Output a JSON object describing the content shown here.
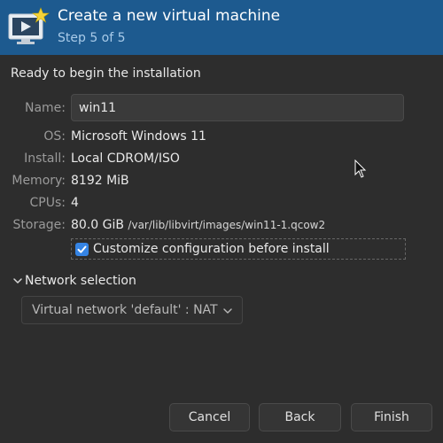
{
  "header": {
    "title": "Create a new virtual machine",
    "subtitle": "Step 5 of 5"
  },
  "ready_text": "Ready to begin the installation",
  "fields": {
    "name_label": "Name:",
    "name_value": "win11",
    "os_label": "OS:",
    "os_value": "Microsoft Windows 11",
    "install_label": "Install:",
    "install_value": "Local CDROM/ISO",
    "memory_label": "Memory:",
    "memory_value": "8192 MiB",
    "cpus_label": "CPUs:",
    "cpus_value": "4",
    "storage_label": "Storage:",
    "storage_size": "80.0 GiB",
    "storage_path": "/var/lib/libvirt/images/win11-1.qcow2"
  },
  "customize": {
    "label": "Customize configuration before install",
    "checked": true
  },
  "network": {
    "expander_label": "Network selection",
    "selected": "Virtual network 'default' : NAT"
  },
  "buttons": {
    "cancel": "Cancel",
    "back": "Back",
    "finish": "Finish"
  },
  "colors": {
    "header_bg": "#1d5a8f",
    "accent": "#3584e4",
    "window_bg": "#2d2d2d"
  },
  "icons": {
    "header": "virtual-machine-monitor-icon",
    "checkbox": "checkmark-icon",
    "expander": "chevron-down-icon",
    "dropdown": "chevron-down-icon"
  }
}
